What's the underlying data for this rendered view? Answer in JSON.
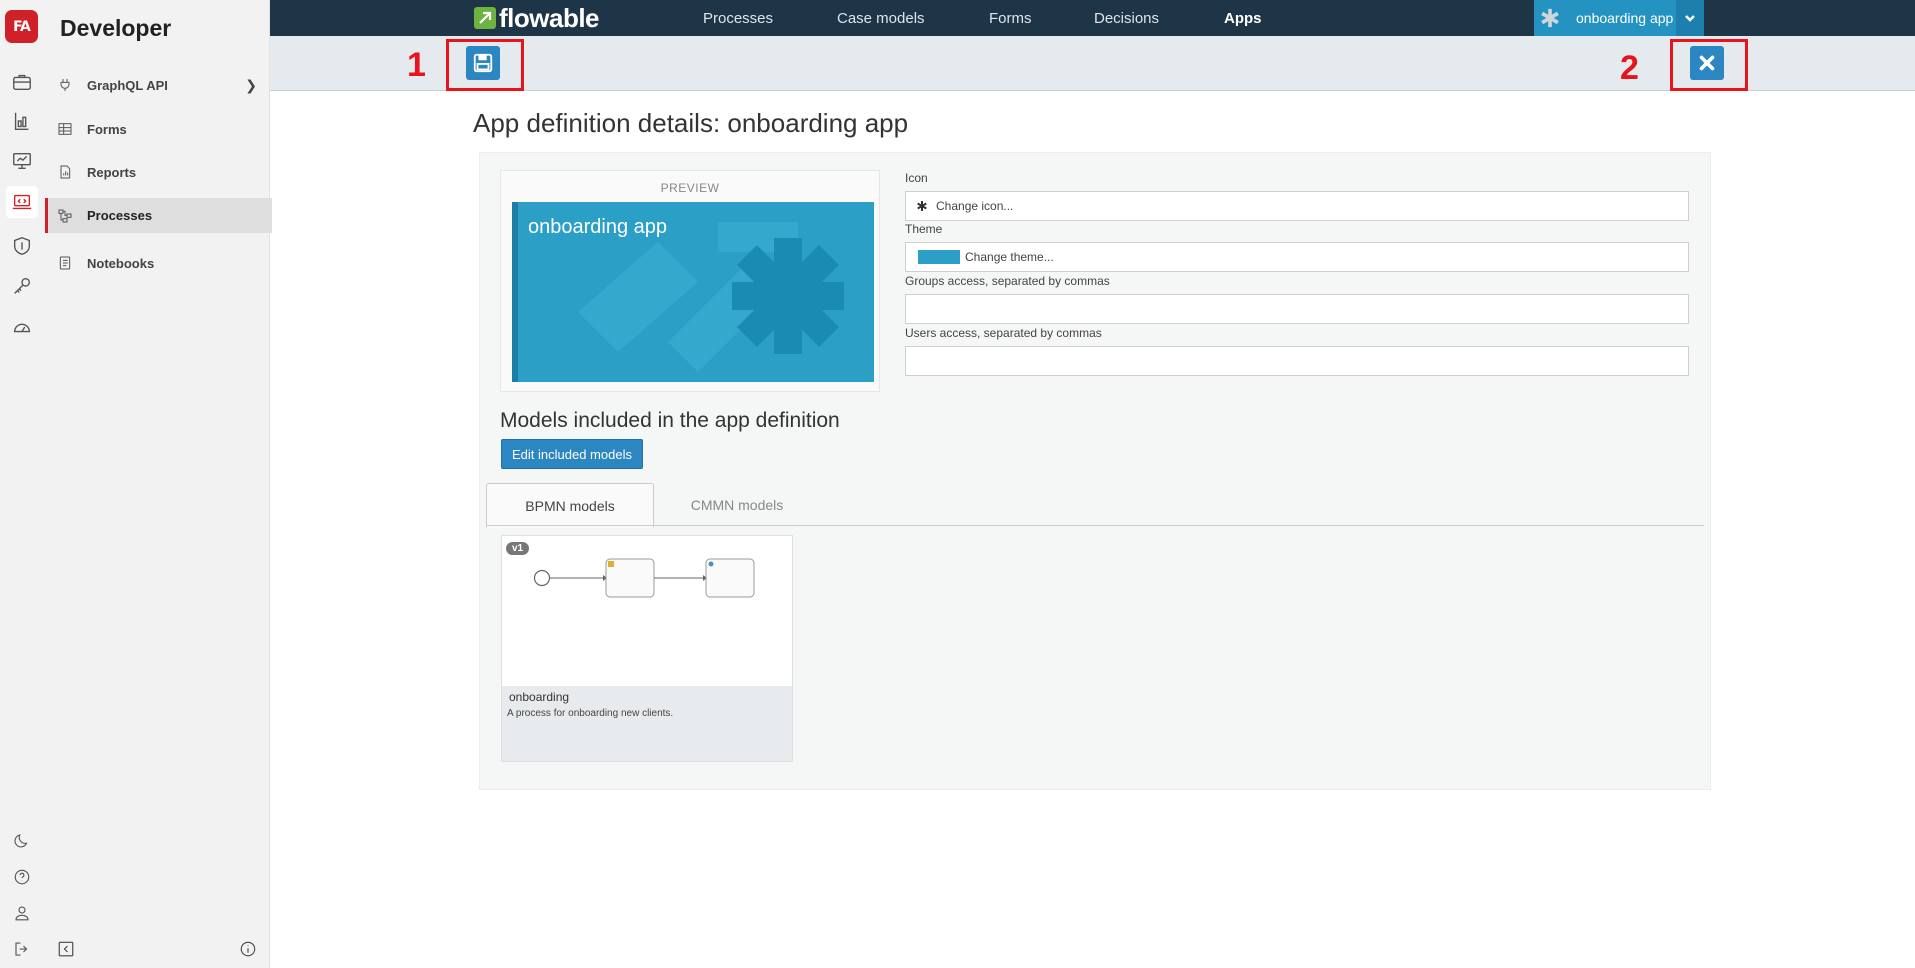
{
  "rail": {
    "logo": "FA",
    "items": [
      "briefcase-icon",
      "chart-icon",
      "monitor-chart-icon",
      "laptop-code-icon",
      "shield-icon",
      "key-icon",
      "gauge-icon"
    ],
    "bottom_items": [
      "moon-icon",
      "help-icon",
      "user-icon",
      "logout-icon"
    ]
  },
  "sidebar": {
    "title": "Developer",
    "items": [
      {
        "label": "GraphQL API",
        "icon": "plug-icon"
      },
      {
        "label": "Forms",
        "icon": "table-icon"
      },
      {
        "label": "Reports",
        "icon": "file-chart-icon"
      },
      {
        "label": "Processes",
        "icon": "flow-icon",
        "active": true
      },
      {
        "label": "Notebooks",
        "icon": "notebook-icon"
      }
    ]
  },
  "topbar": {
    "brand": "flowable",
    "nav": [
      "Processes",
      "Case models",
      "Forms",
      "Decisions",
      "Apps"
    ],
    "active_nav": "Apps",
    "app_switcher": "onboarding app"
  },
  "toolbar": {
    "markers": [
      "1",
      "2"
    ]
  },
  "page": {
    "title": "App definition details: onboarding app",
    "preview_caption": "PREVIEW",
    "tile_name": "onboarding app",
    "fields": {
      "icon_label": "Icon",
      "icon_value": "Change icon...",
      "theme_label": "Theme",
      "theme_value": "Change theme...",
      "groups_label": "Groups access, separated by commas",
      "groups_value": "",
      "users_label": "Users access, separated by commas",
      "users_value": ""
    },
    "models_heading": "Models included in the app definition",
    "edit_button": "Edit included models",
    "tabs": [
      "BPMN models",
      "CMMN models"
    ],
    "model": {
      "version": "v1",
      "name": "onboarding",
      "description": "A process for onboarding new clients."
    }
  },
  "colors": {
    "brand_red": "#cf2127",
    "topbar": "#1e3547",
    "accent_blue": "#2b86c1",
    "theme_teal": "#2b9fc5",
    "annotation_red": "#e8131b"
  }
}
